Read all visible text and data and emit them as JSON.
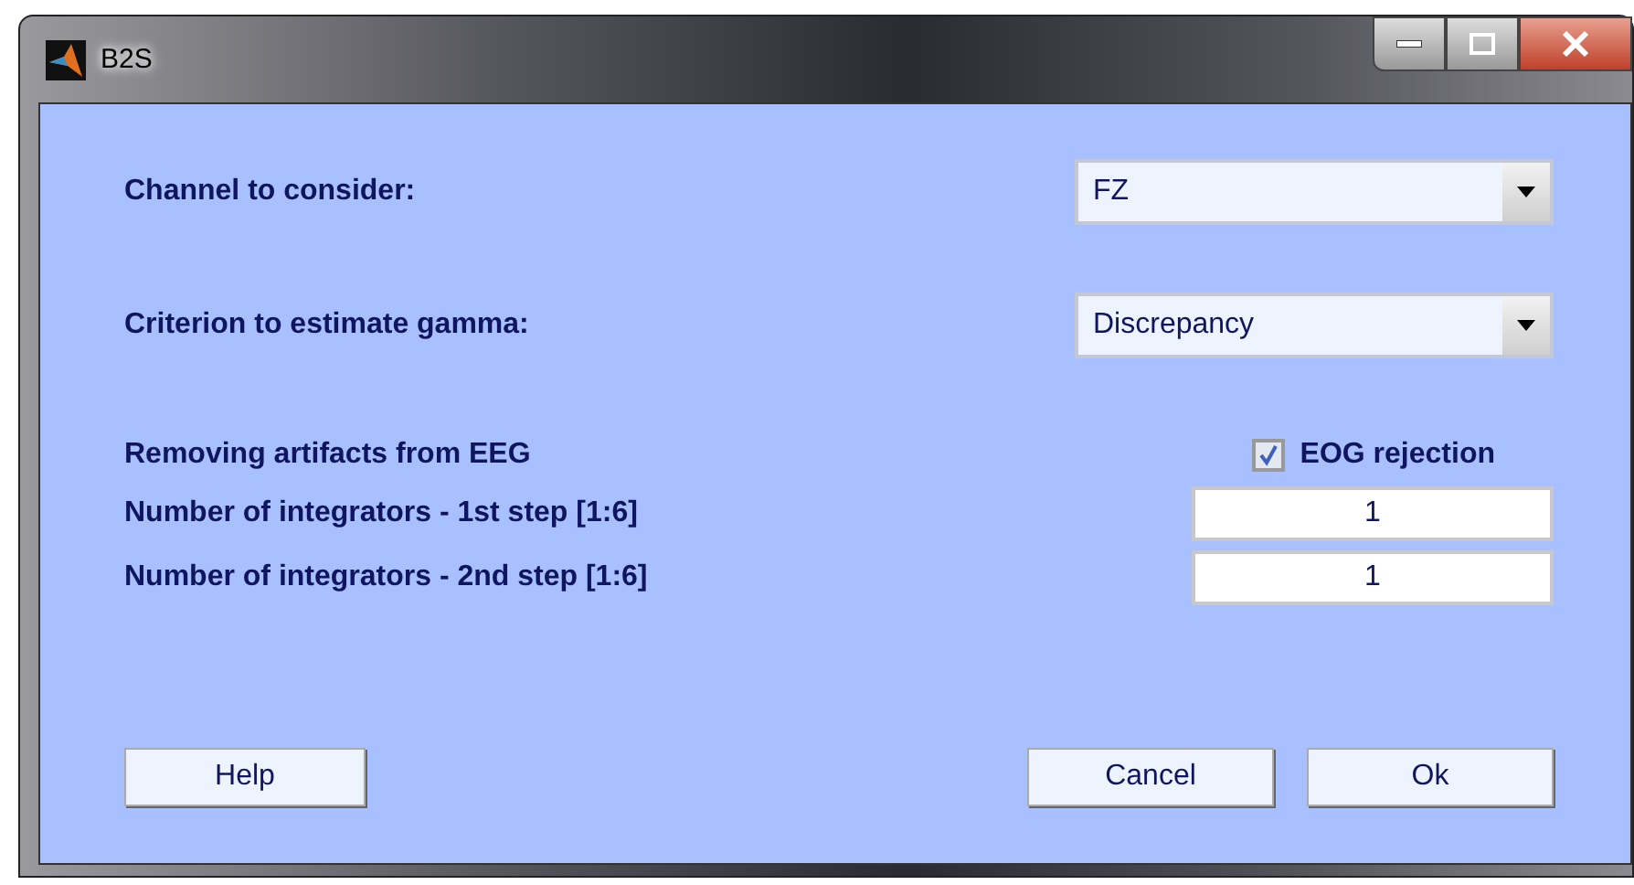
{
  "window": {
    "title": "B2S"
  },
  "channel": {
    "label": "Channel to consider:",
    "value": "FZ"
  },
  "criterion": {
    "label": "Criterion to estimate gamma:",
    "value": "Discrepancy"
  },
  "artifacts": {
    "label": "Removing artifacts from EEG",
    "checkbox_label": "EOG rejection",
    "checked": true
  },
  "integrators": [
    {
      "label": "Number of integrators - 1st step [1:6]",
      "value": "1"
    },
    {
      "label": "Number of integrators - 2nd step [1:6]",
      "value": "1"
    }
  ],
  "buttons": {
    "help": "Help",
    "cancel": "Cancel",
    "ok": "Ok"
  }
}
